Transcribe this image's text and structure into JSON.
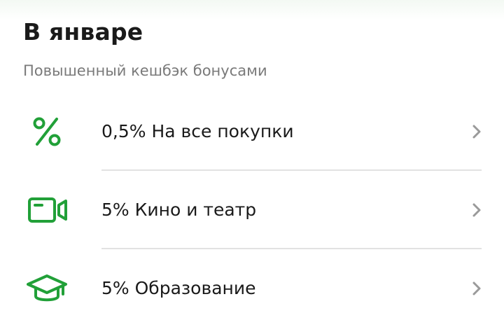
{
  "header": {
    "title": "В январе",
    "subtitle": "Повышенный кешбэк бонусами"
  },
  "accent_color": "#21a038",
  "chevron_color": "#9a9a9a",
  "items": [
    {
      "label": "0,5% На все покупки",
      "icon": "percent-icon"
    },
    {
      "label": "5% Кино и театр",
      "icon": "video-camera-icon"
    },
    {
      "label": "5% Образование",
      "icon": "graduation-cap-icon"
    }
  ]
}
